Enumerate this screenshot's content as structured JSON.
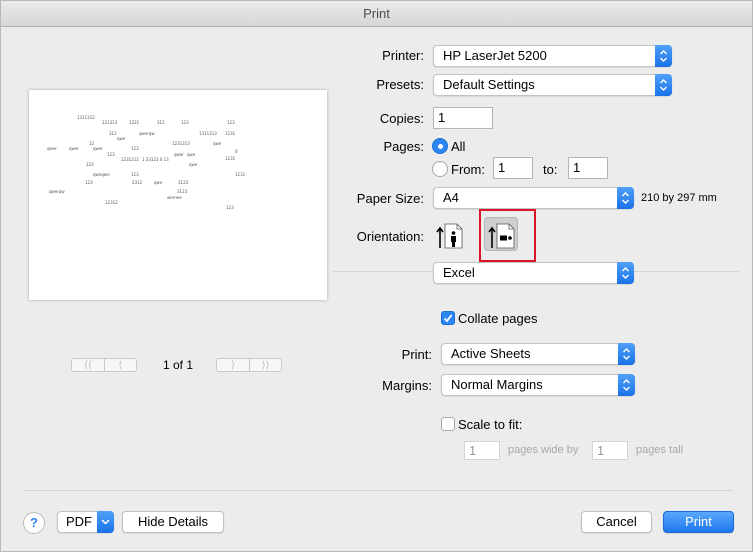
{
  "window": {
    "title": "Print"
  },
  "printer": {
    "label": "Printer:",
    "value": "HP LaserJet 5200"
  },
  "presets": {
    "label": "Presets:",
    "value": "Default Settings"
  },
  "copies": {
    "label": "Copies:",
    "value": "1"
  },
  "pages": {
    "label": "Pages:",
    "all_label": "All",
    "from_label": "From:",
    "from_value": "1",
    "to_label": "to:",
    "to_value": "1"
  },
  "paper_size": {
    "label": "Paper Size:",
    "value": "A4",
    "dimensions": "210 by 297 mm"
  },
  "orientation": {
    "label": "Orientation:"
  },
  "section_popup": {
    "value": "Excel"
  },
  "collate": {
    "label": "Collate pages",
    "checked": true
  },
  "print_what": {
    "label": "Print:",
    "value": "Active Sheets"
  },
  "margins": {
    "label": "Margins:",
    "value": "Normal Margins"
  },
  "scale": {
    "label": "Scale to fit:",
    "checked": false,
    "wide_value": "1",
    "wide_label": "pages wide by",
    "tall_value": "1",
    "tall_label": "pages tall"
  },
  "preview": {
    "page_indicator": "1 of 1",
    "sample_text": [
      "1311312",
      "121313",
      "1221",
      "312",
      "123",
      "123",
      "312",
      "qwerqw",
      "1311313",
      "1231",
      "qwe",
      "1231313",
      "qwe",
      "12",
      "qwer",
      "qwer",
      "qwer",
      "123",
      "123",
      "qwer",
      "0",
      "1231312",
      "1 23123 0 13",
      "qwe",
      "123",
      "qwe",
      "1231",
      "qweqwe",
      "123",
      "1231",
      "123",
      "2312",
      "qwe",
      "3123",
      "qwerqw",
      "3123",
      "12312",
      "werrwe",
      "123"
    ]
  },
  "buttons": {
    "help": "?",
    "pdf": "PDF",
    "hide_details": "Hide Details",
    "cancel": "Cancel",
    "print": "Print"
  },
  "colors": {
    "accent": "#2d87f3",
    "highlight": "#d9142b"
  }
}
